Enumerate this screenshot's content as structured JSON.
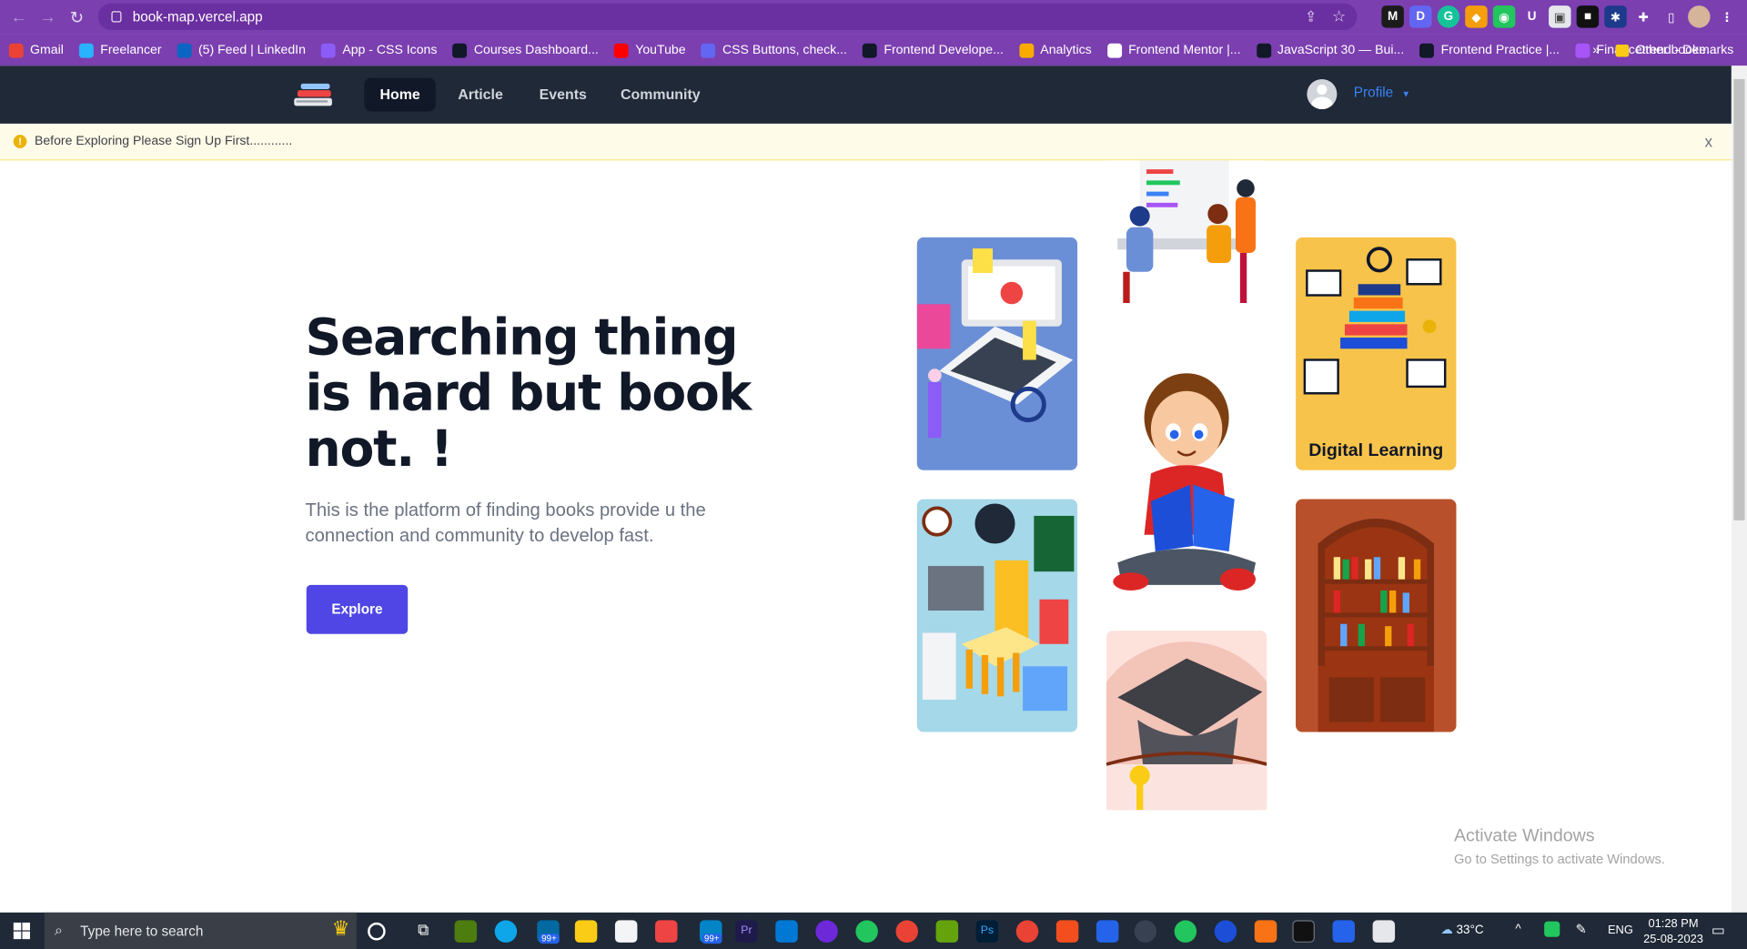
{
  "browser": {
    "url": "book-map.vercel.app",
    "bookmarks": [
      {
        "label": "Gmail",
        "color": "#ea4335"
      },
      {
        "label": "Freelancer",
        "color": "#29b2fe"
      },
      {
        "label": "(5) Feed | LinkedIn",
        "color": "#0a66c2"
      },
      {
        "label": "App - CSS Icons",
        "color": "#8b5cf6"
      },
      {
        "label": "Courses Dashboard...",
        "color": "#111827"
      },
      {
        "label": "YouTube",
        "color": "#ff0000"
      },
      {
        "label": "CSS Buttons, check...",
        "color": "#6366f1"
      },
      {
        "label": "Frontend Develope...",
        "color": "#111827"
      },
      {
        "label": "Analytics",
        "color": "#f9ab00"
      },
      {
        "label": "Frontend Mentor |...",
        "color": "#ffffff"
      },
      {
        "label": "JavaScript 30 — Bui...",
        "color": "#111827"
      },
      {
        "label": "Frontend Practice |...",
        "color": "#111827"
      },
      {
        "label": "Financetrend - Dee...",
        "color": "#a855f7"
      }
    ],
    "more_bookmarks": "»",
    "other_bookmarks": "Other bookmarks"
  },
  "header": {
    "nav": [
      {
        "label": "Home",
        "active": true
      },
      {
        "label": "Article",
        "active": false
      },
      {
        "label": "Events",
        "active": false
      },
      {
        "label": "Community",
        "active": false
      }
    ],
    "profile_label": "Profile"
  },
  "alert": {
    "text": "Before Exploring Please Sign Up First............",
    "close": "x"
  },
  "hero": {
    "title": "Searching thing is hard but book not. !",
    "subtitle": "This is the platform of finding books provide u the connection and community to develop fast.",
    "cta": "Explore"
  },
  "gallery": {
    "digital_learning_caption": "Digital Learning"
  },
  "windows": {
    "activate_title": "Activate Windows",
    "activate_sub": "Go to Settings to activate Windows.",
    "search_placeholder": "Type here to search",
    "temperature": "33°C",
    "language": "ENG",
    "time": "01:28 PM",
    "date": "25-08-2023",
    "badge_mail": "99+",
    "badge_store": "99+"
  },
  "colors": {
    "browser_purple": "#7b3fb0",
    "header_bg": "#1f2937",
    "cta": "#4f46e5",
    "alert_bg": "#fefce8"
  }
}
